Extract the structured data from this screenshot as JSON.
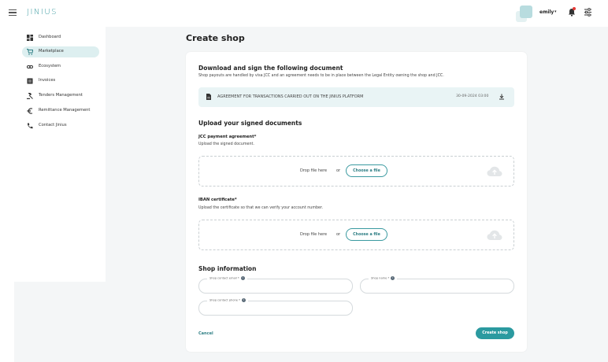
{
  "header": {
    "logo": "JINIUS",
    "username": "emily",
    "caret": "▾"
  },
  "sidebar": {
    "items": [
      {
        "label": "Dashboard",
        "icon": "dashboard-icon",
        "active": false
      },
      {
        "label": "Marketplace",
        "icon": "cart-icon",
        "active": true
      },
      {
        "label": "Ecosystem",
        "icon": "link-icon",
        "active": false
      },
      {
        "label": "Invoices",
        "icon": "invoice-icon",
        "active": false
      },
      {
        "label": "Tenders Management",
        "icon": "gavel-icon",
        "active": false
      },
      {
        "label": "Remittance Management",
        "icon": "euro-icon",
        "active": false
      },
      {
        "label": "Contact Jinius",
        "icon": "phone-icon",
        "active": false
      }
    ]
  },
  "page": {
    "title": "Create shop"
  },
  "download_section": {
    "title": "Download and sign the following document",
    "description": "Shop payouts are handled by visa JCC and an agreement needs to be in place between the Legal Entity owning the shop and JCC.",
    "document_name": "AGREEMENT FOR TRANSACTIONS CARRIED OUT ON THE JINIUS PLATFORM",
    "document_date": "30-09-2024 03:00"
  },
  "upload_section": {
    "title": "Upload your signed documents",
    "jcc": {
      "label": "JCC payment agreement*",
      "description": "Upload the signed document.",
      "drop_text": "Drop file here",
      "or_text": "or",
      "button": "Choose a file"
    },
    "iban": {
      "label": "IBAN certificate*",
      "description": "Upload the certificate so that we can verify your account number.",
      "drop_text": "Drop file here",
      "or_text": "or",
      "button": "Choose a file"
    }
  },
  "shop_info": {
    "title": "Shop information",
    "email_label": "Shop contact email *",
    "name_label": "Shop name *",
    "phone_label": "Shop contact phone *",
    "email_value": "",
    "name_value": "",
    "phone_value": "",
    "info_glyph": "i"
  },
  "actions": {
    "cancel": "Cancel",
    "create": "Create shop"
  },
  "colors": {
    "accent": "#2b9aa0",
    "active_nav": "#ddeff0",
    "doc_row": "#e9f4f5"
  }
}
